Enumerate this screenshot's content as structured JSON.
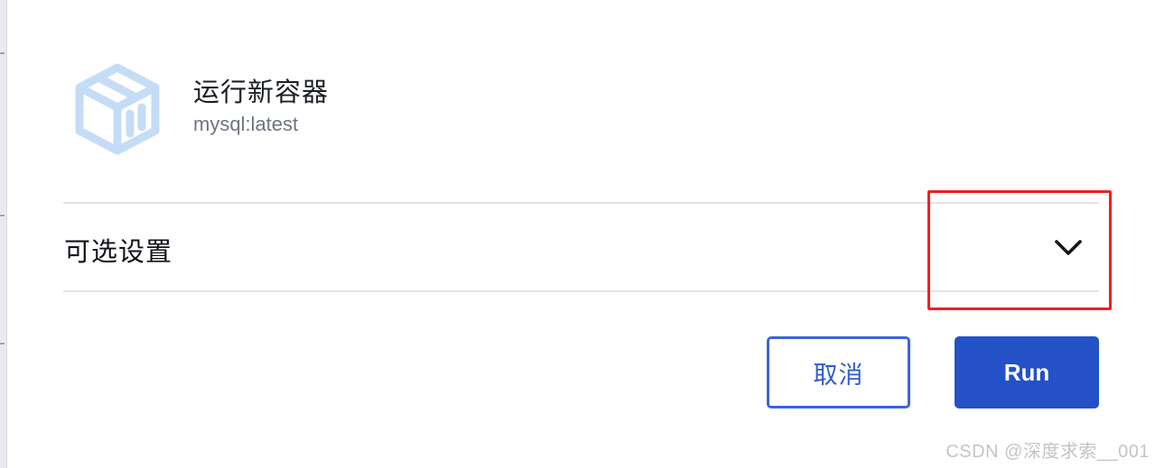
{
  "dialog": {
    "title": "运行新容器",
    "image_name": "mysql:latest",
    "icon": "container-cube-icon",
    "icon_color": "#c5dcf6"
  },
  "optional_settings": {
    "label": "可选设置",
    "expanded": false,
    "toggle_icon": "chevron-down-icon"
  },
  "annotation": {
    "color": "#ee2020"
  },
  "actions": {
    "cancel_label": "取消",
    "run_label": "Run",
    "primary_color": "#2451c8"
  },
  "watermark": {
    "text": "CSDN @深度求索__001"
  }
}
